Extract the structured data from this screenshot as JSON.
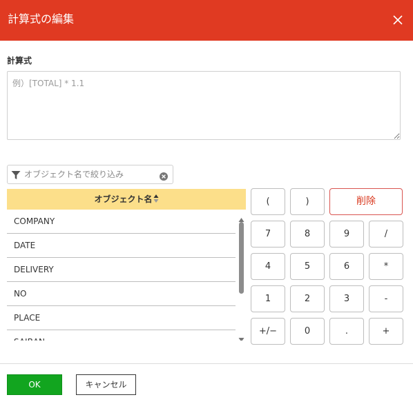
{
  "dialog": {
    "title": "計算式の編集",
    "close_icon": "close-icon",
    "header_color": "#e03a22"
  },
  "formula": {
    "label": "計算式",
    "value": "",
    "placeholder": "例）[TOTAL] * 1.1"
  },
  "filter": {
    "icon": "filter-icon",
    "placeholder": "オブジェクト名で絞り込み",
    "value": "",
    "clear_icon": "clear-icon"
  },
  "object_table": {
    "header": "オブジェクト名",
    "sort_icon": "sort-icon",
    "header_color": "#fcdf8a",
    "rows": [
      "COMPANY",
      "DATE",
      "DELIVERY",
      "NO",
      "PLACE",
      "SAIBAN"
    ]
  },
  "keypad": {
    "open_paren": "(",
    "close_paren": ")",
    "delete": "削除",
    "k7": "7",
    "k8": "8",
    "k9": "9",
    "divide": "/",
    "k4": "4",
    "k5": "5",
    "k6": "6",
    "multiply": "*",
    "k1": "1",
    "k2": "2",
    "k3": "3",
    "minus": "-",
    "plus_minus": "+/−",
    "k0": "0",
    "decimal": ".",
    "plus": "+"
  },
  "footer": {
    "ok_label": "OK",
    "cancel_label": "キャンセル",
    "ok_color": "#12a51f"
  }
}
